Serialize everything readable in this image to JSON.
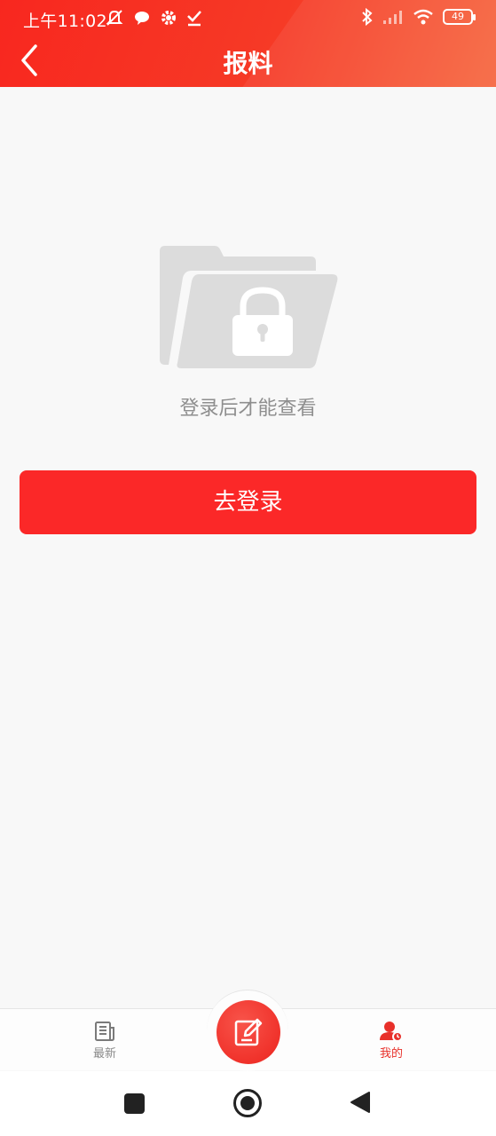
{
  "status_bar": {
    "time": "上午11:02",
    "battery": "49"
  },
  "header": {
    "title": "报料"
  },
  "empty_state": {
    "message": "登录后才能查看"
  },
  "login_button": {
    "label": "去登录"
  },
  "tab_bar": {
    "tabs": [
      {
        "label": "最新",
        "icon": "newspaper-icon",
        "active": false
      },
      {
        "label": "",
        "icon": "edit-icon",
        "active": false
      },
      {
        "label": "我的",
        "icon": "user-icon",
        "active": true
      }
    ]
  },
  "colors": {
    "accent": "#fb2828",
    "header_start": "#f8271f",
    "header_end": "#f6663f",
    "background": "#f8f8f8",
    "muted_text": "#8e8e8e",
    "illustration": "#dcdcdc"
  }
}
